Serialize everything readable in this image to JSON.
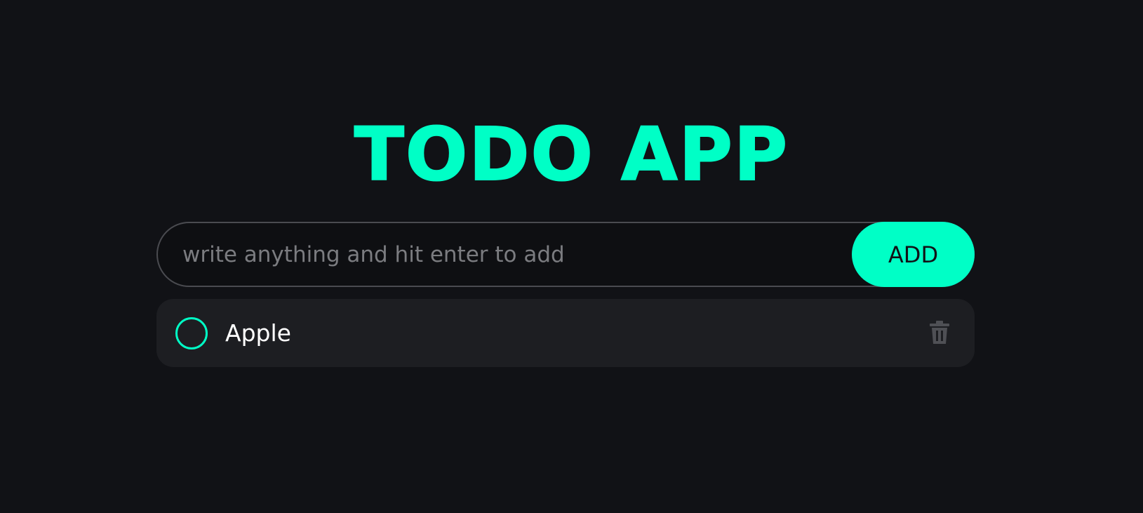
{
  "header": {
    "title": "TODO APP"
  },
  "add_form": {
    "placeholder": "write anything and hit enter to add",
    "value": "",
    "button_label": "ADD"
  },
  "todos": [
    {
      "text": "Apple",
      "completed": false
    }
  ],
  "icons": {
    "checkbox": "circle-outline-icon",
    "delete": "trash-icon"
  },
  "colors": {
    "background": "#111216",
    "accent": "#00ffc6",
    "item_background": "#1d1e22",
    "muted_icon": "#4f5055"
  }
}
